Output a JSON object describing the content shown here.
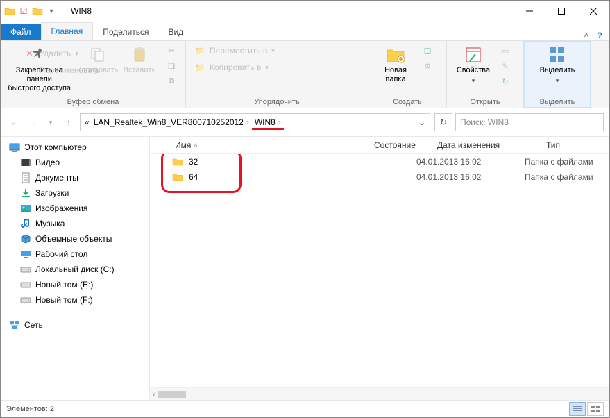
{
  "title": "WIN8",
  "tabs": {
    "file": "Файл",
    "home": "Главная",
    "share": "Поделиться",
    "view": "Вид"
  },
  "ribbon": {
    "clipboard": {
      "group": "Буфер обмена",
      "pin": "Закрепить на панели\nбыстрого доступа",
      "copy": "Копировать",
      "paste": "Вставить"
    },
    "organize": {
      "group": "Упорядочить",
      "move_to": "Переместить в",
      "copy_to": "Копировать в",
      "delete": "Удалить",
      "rename": "Переименовать"
    },
    "new": {
      "group": "Создать",
      "new_folder": "Новая\nпапка"
    },
    "open": {
      "group": "Открыть",
      "properties": "Свойства"
    },
    "select": {
      "group": "Выделить",
      "select": "Выделить"
    }
  },
  "breadcrumb": {
    "prefix": "«",
    "parent": "LAN_Realtek_Win8_VER800710252012",
    "current": "WIN8"
  },
  "search_placeholder": "Поиск: WIN8",
  "sidebar": {
    "computer": "Этот компьютер",
    "items": [
      {
        "label": "Видео",
        "icon": "video"
      },
      {
        "label": "Документы",
        "icon": "doc"
      },
      {
        "label": "Загрузки",
        "icon": "download"
      },
      {
        "label": "Изображения",
        "icon": "image"
      },
      {
        "label": "Музыка",
        "icon": "music"
      },
      {
        "label": "Объемные объекты",
        "icon": "3d"
      },
      {
        "label": "Рабочий стол",
        "icon": "desktop"
      },
      {
        "label": "Локальный диск (C:)",
        "icon": "disk"
      },
      {
        "label": "Новый том (E:)",
        "icon": "disk"
      },
      {
        "label": "Новый том (F:)",
        "icon": "disk"
      }
    ],
    "network": "Сеть"
  },
  "columns": {
    "name": "Имя",
    "state": "Состояние",
    "date": "Дата изменения",
    "type": "Тип"
  },
  "rows": [
    {
      "name": "32",
      "date": "04.01.2013 16:02",
      "type": "Папка с файлами"
    },
    {
      "name": "64",
      "date": "04.01.2013 16:02",
      "type": "Папка с файлами"
    }
  ],
  "status": "Элементов: 2"
}
